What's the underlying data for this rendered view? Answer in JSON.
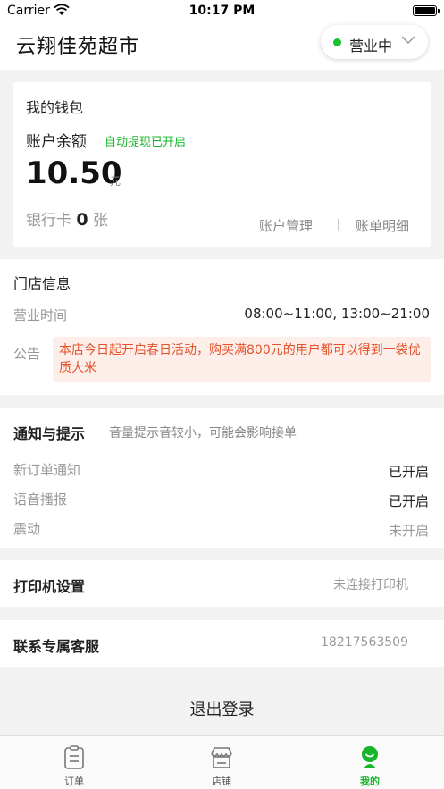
{
  "status_bar": {
    "carrier": "Carrier",
    "time": "10:17 PM"
  },
  "header": {
    "store_name": "云翔佳苑超市",
    "status_label": "营业中",
    "status_color": "#17c12b"
  },
  "wallet": {
    "title": "我的钱包",
    "balance_label": "账户余额",
    "auto_withdraw": "自动提现已开启",
    "amount": "10.50",
    "unit": "元",
    "bank_prefix": "银行卡",
    "bank_count": "0",
    "bank_suffix": "张",
    "account_mgmt": "账户管理",
    "bill_details": "账单明细"
  },
  "store_info": {
    "title": "门店信息",
    "hours_label": "营业时间",
    "hours_value": "08:00~11:00, 13:00~21:00",
    "notice_label": "公告",
    "notice_text": "本店今日起开启春日活动，购买满800元的用户都可以得到一袋优质大米"
  },
  "notifications": {
    "title": "通知与提示",
    "hint": "音量提示音较小，可能会影响接单",
    "rows": [
      {
        "label": "新订单通知",
        "value": "已开启"
      },
      {
        "label": "语音播报",
        "value": "已开启"
      },
      {
        "label": "震动",
        "value": "未开启"
      }
    ]
  },
  "printer": {
    "label": "打印机设置",
    "value": "未连接打印机"
  },
  "service": {
    "label": "联系专属客服",
    "value": "18217563509"
  },
  "logout": {
    "label": "退出登录"
  },
  "tabbar": {
    "items": [
      {
        "label": "订单",
        "icon": "order-icon"
      },
      {
        "label": "店铺",
        "icon": "shop-icon"
      },
      {
        "label": "我的",
        "icon": "profile-icon"
      }
    ],
    "active_color": "#17b52a"
  }
}
